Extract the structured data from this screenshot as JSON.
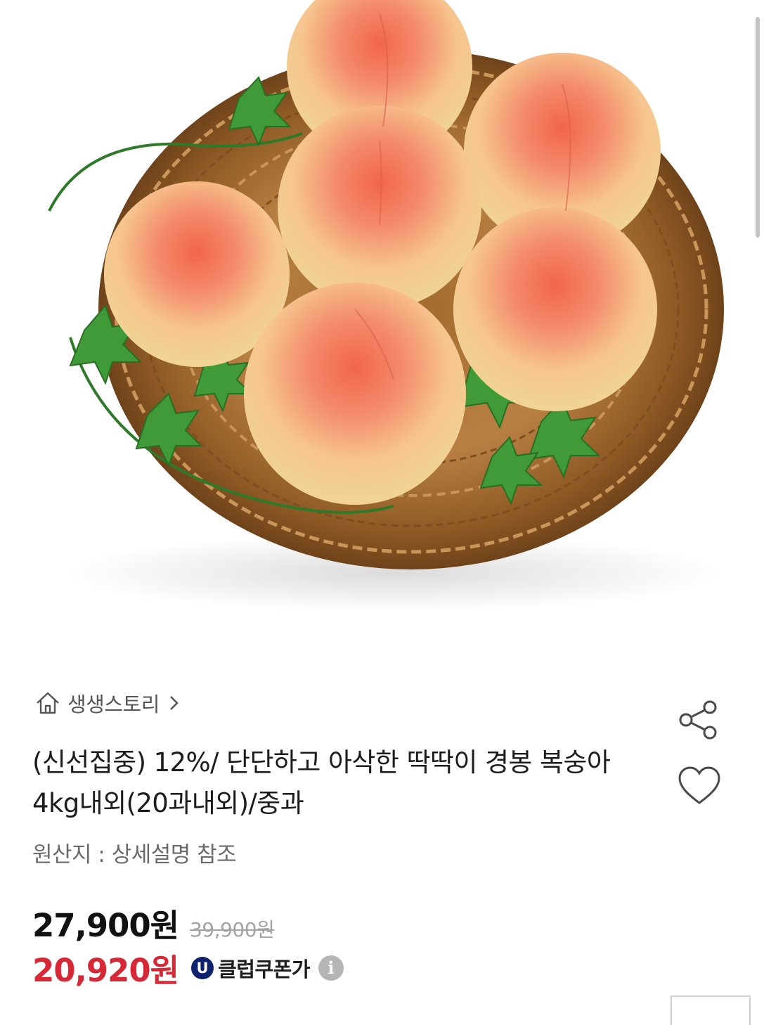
{
  "hero": {
    "image": "peaches-in-wicker-basket-with-ivy"
  },
  "store": {
    "home_icon": "home-icon",
    "name": "생생스토리",
    "chevron_icon": "chevron-right-icon"
  },
  "product": {
    "title": "(신선집중) 12%/ 단단하고 아삭한 딱딱이 경봉 복숭아 4kg내외(20과내외)/중과",
    "origin": "원산지 : 상세설명 참조"
  },
  "actions": {
    "share_icon": "share-icon",
    "wishlist_icon": "heart-icon"
  },
  "pricing": {
    "sale_price": "27,900원",
    "original_price": "39,900원",
    "coupon_price": "20,920원",
    "coupon_badge": "U",
    "coupon_label": "클럽쿠폰가",
    "info_glyph": "i"
  },
  "colors": {
    "coupon_price": "#d62835",
    "coupon_badge_bg": "#10226d",
    "strikethrough": "#a3a3a3"
  }
}
